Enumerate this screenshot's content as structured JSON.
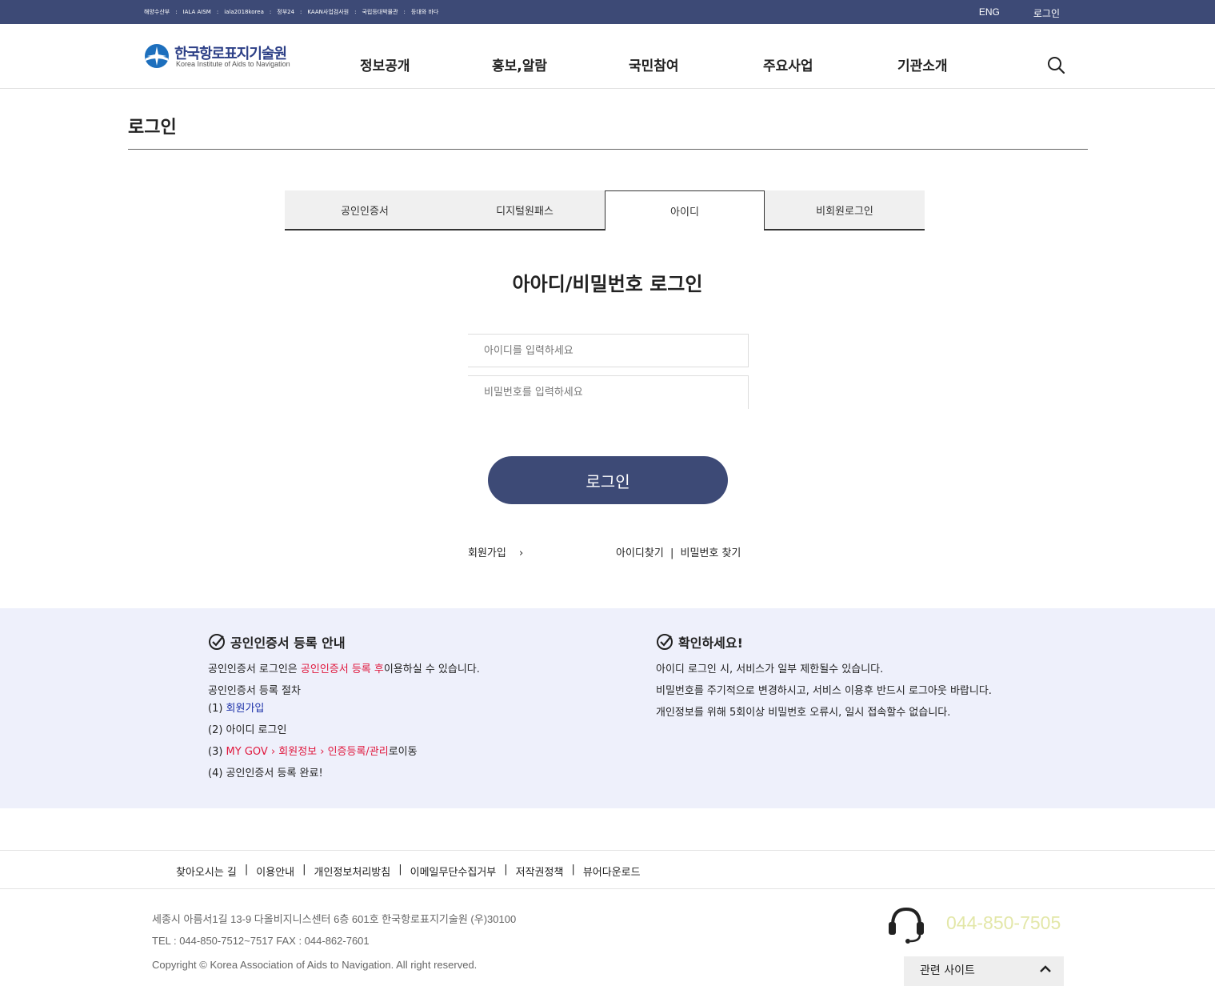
{
  "colors": {
    "primary": "#3d4a76",
    "info_bg": "#eef0fb",
    "highlight_red": "#e0193e",
    "link_blue": "#1a2fa8",
    "phone": "#e3e7a8"
  },
  "topbar": {
    "links": [
      "해양수산부",
      "IALA AISM",
      "iala2018korea",
      "정부24",
      "KAAN사업검사원",
      "국립등대박물관",
      "등대와 바다"
    ],
    "lang": "ENG",
    "login": "로그인"
  },
  "header": {
    "logo_ko": "한국항로표지기술원",
    "logo_en": "Korea Institute of Aids to Navigation",
    "nav": [
      "정보공개",
      "홍보,알람",
      "국민참여",
      "주요사업",
      "기관소개"
    ],
    "search_icon": "search-icon"
  },
  "page": {
    "title": "로그인"
  },
  "tabs": [
    {
      "label": "공인인증서",
      "active": false
    },
    {
      "label": "디지털원패스",
      "active": false
    },
    {
      "label": "아이디",
      "active": true
    },
    {
      "label": "비회원로그인",
      "active": false
    }
  ],
  "login": {
    "heading": "아아디/비밀번호 로그인",
    "id_placeholder": "아이디를 입력하세요",
    "pw_placeholder": "비밀번호를 입력하세요",
    "button": "로그인",
    "signup": "회원가입",
    "signup_arrow": "›",
    "find_id": "아이디찾기",
    "find_sep": "|",
    "find_pw": "비밀번호 찾기"
  },
  "info": {
    "left": {
      "title": "공인인증서 등록 안내",
      "line1_a": "공인인증서 로그인은 ",
      "line1_red": "공인인증서 등록 후",
      "line1_b": "이용하실 수 있습니다.",
      "line2": "공인인증서 등록 절차",
      "step1_num": "(1) ",
      "step1_link": "회원가입",
      "step2": "(2) 아이디 로그인",
      "step3_num": "(3) ",
      "step3_red": "MY GOV › 회원정보 › 인증등록/관리",
      "step3_b": "로이동",
      "step4": "(4) 공인인증서 등록 완료!"
    },
    "right": {
      "title": "확인하세요!",
      "p1": "아이디 로그인 시, 서비스가 일부 제한될수 있습니다.",
      "p2": "비밀번호를 주기적으로 변경하시고, 서비스 이용후 반드시 로그아웃 바랍니다.",
      "p3": "개인정보를 위해 5회이상 비밀번호 오류시, 일시 접속할수 없습니다."
    }
  },
  "footer": {
    "nav": [
      "찾아오시는 길",
      "이용안내",
      "개인정보처리방침",
      "이메일무단수집거부",
      "저작권정책",
      "뷰어다운로드"
    ],
    "nav_sep": "|",
    "address": "세종시 아름서1길 13-9 다올비지니스센터 6층 601호 한국항로표지기술원 (우)30100",
    "tel": "TEL : 044-850-7512~7517 FAX : 044-862-7601",
    "copyright": "Copyright © Korea Association of Aids to Navigation. All right reserved.",
    "phone": "044-850-7505",
    "related": "관련 사이트"
  }
}
